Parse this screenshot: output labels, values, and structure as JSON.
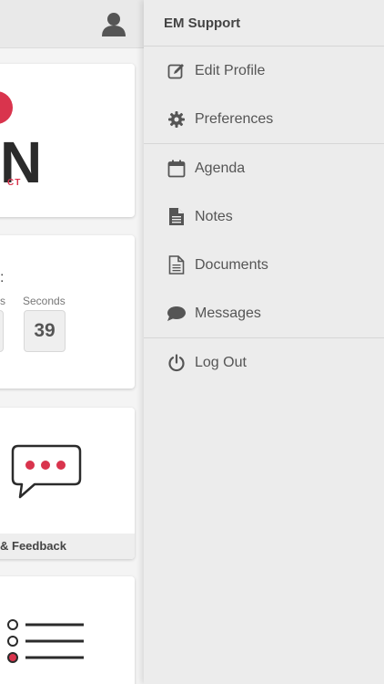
{
  "menu": {
    "title": "EM Support",
    "groups": [
      [
        {
          "label": "Edit Profile",
          "icon": "edit-icon"
        },
        {
          "label": "Preferences",
          "icon": "gear-icon"
        }
      ],
      [
        {
          "label": "Agenda",
          "icon": "calendar-icon"
        },
        {
          "label": "Notes",
          "icon": "notes-icon"
        },
        {
          "label": "Documents",
          "icon": "document-icon"
        },
        {
          "label": "Messages",
          "icon": "chat-bubble-icon"
        }
      ],
      [
        {
          "label": "Log Out",
          "icon": "power-icon"
        }
      ]
    ]
  },
  "content": {
    "logo_letter": "N",
    "logo_sub": "CT",
    "countdown": {
      "colon": ":",
      "prev_label": "s",
      "seconds_label": "Seconds",
      "seconds_value": "39"
    },
    "feedback_label": "& Feedback"
  },
  "colors": {
    "accent": "#d9344d",
    "menu_bg": "#ececec",
    "text": "#555555"
  }
}
